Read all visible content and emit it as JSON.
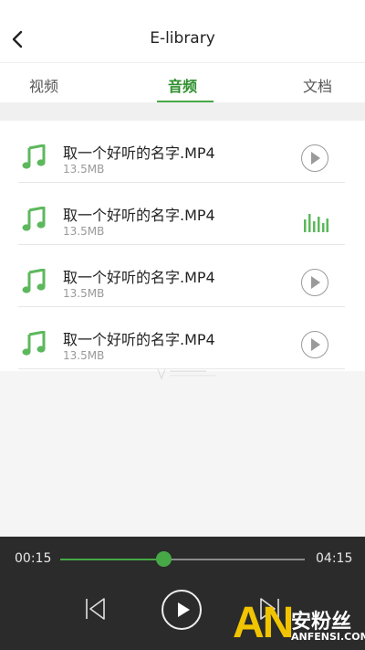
{
  "header": {
    "title": "E-library"
  },
  "tabs": [
    {
      "label": "视频",
      "active": false
    },
    {
      "label": "音频",
      "active": true
    },
    {
      "label": "文档",
      "active": false
    }
  ],
  "tracks": [
    {
      "name": "取一个好听的名字.MP4",
      "size": "13.5MB",
      "state": "paused"
    },
    {
      "name": "取一个好听的名字.MP4",
      "size": "13.5MB",
      "state": "playing"
    },
    {
      "name": "取一个好听的名字.MP4",
      "size": "13.5MB",
      "state": "paused"
    },
    {
      "name": "取一个好听的名字.MP4",
      "size": "13.5MB",
      "state": "paused"
    }
  ],
  "player": {
    "current_time": "00:15",
    "total_time": "04:15",
    "progress": 0.42
  },
  "watermark": {
    "logo_text": "AN",
    "site_cn": "安粉丝",
    "site_en": "ANFENSI.COM"
  },
  "icons": {
    "back": "chevron-left-icon",
    "track": "music-note-icon",
    "row_play": "play-circle-icon",
    "row_playing": "equalizer-icon",
    "prev": "skip-previous-icon",
    "play": "play-icon",
    "next": "skip-next-icon"
  },
  "colors": {
    "accent": "#46a946",
    "header_bg": "#ffffff",
    "player_bg": "#2b2b2b",
    "watermark": "#f0c400"
  }
}
